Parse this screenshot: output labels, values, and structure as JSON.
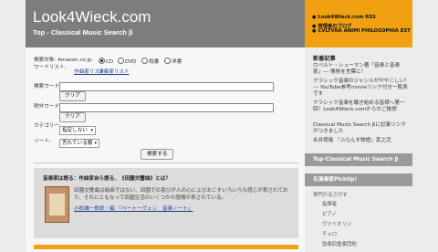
{
  "header": {
    "title": "Look4Wieck.com",
    "subtitle": "Top - Classical Music Search β",
    "right_lines": [
      "Look4Wieck.com RSS",
      "管理者のブログ",
      "CVLTVRA ANIMI PHILOSOPHIA EST"
    ]
  },
  "search": {
    "target_label": "検索対象",
    "target_value": "Amazon.co.jp",
    "radios": [
      {
        "label": "CD",
        "checked": true
      },
      {
        "label": "DVD",
        "checked": false
      },
      {
        "label": "和書",
        "checked": false
      },
      {
        "label": "洋書",
        "checked": false
      }
    ],
    "wordlist_label": "ワードリスト",
    "wordlist_links": [
      "作曲家リスト",
      "演奏家リスト"
    ],
    "search_word_label": "検索ワード",
    "search_word_value": "",
    "clear_label": "クリア",
    "exclude_word_label": "除外ワード",
    "exclude_word_value": "",
    "category_label": "カテゴリー",
    "category_value": "指定しない",
    "sort_label": "ソート",
    "sort_value": "売れている順",
    "submit_label": "検索する"
  },
  "article": {
    "title": "音楽家は語る：作曲家自ら語る、《田園交響曲》とは？",
    "body": "田園交響曲は絵画ではない、田園での喜びが人の心によびおこすいろいろな感じが表されており、それにともなって田園生活のいくつかの感情が表されている。",
    "link": "小松雄一郎訳・編 『ベートーヴェン　音楽ノート』"
  },
  "sidebar": {
    "new_posts_label": "新着記事",
    "new_posts": [
      "ロベルト・シューマン著「音楽と音楽家」--- 情熱を言葉に！",
      "クラシック音楽のジャンルがややこしい！ --- YouTube参考movieリンク付き一覧表です",
      "クラシック音楽を聴き始める皆様へ第一回！Look4Wieck.comからのご挨拶",
      "Classical Music Search βに記事リンクがつきました",
      "永井荷風 「ふらんす物語」其之弐"
    ],
    "section_title": "Top-Classical Music Search β",
    "pickup_title": "名演奏家PickUp!",
    "categories_label": "専門かるさがす",
    "categories": [
      "指揮者",
      "ピアノ",
      "ヴァイオリン",
      "チェロ",
      "弦楽四重奏団他"
    ]
  }
}
